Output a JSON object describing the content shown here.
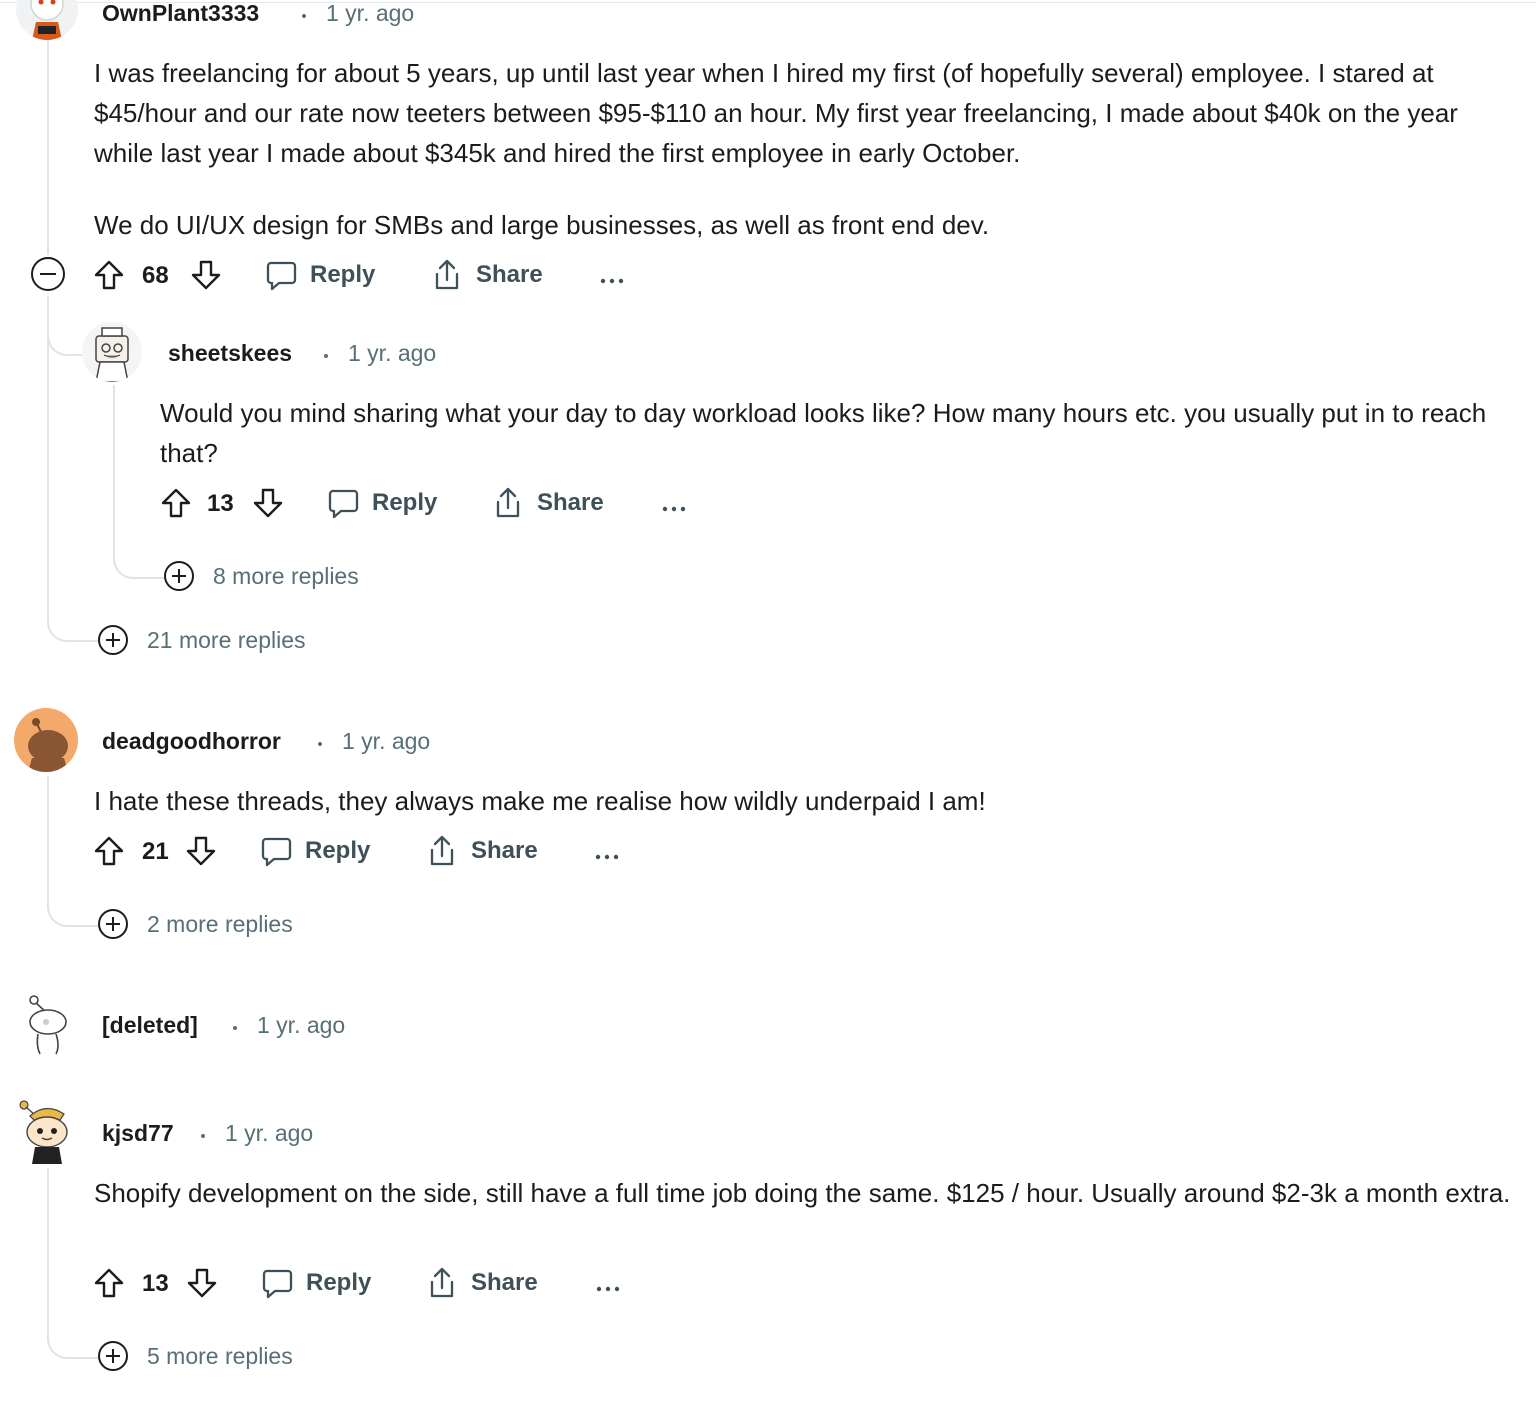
{
  "comments": [
    {
      "username": "OwnPlant3333",
      "time": "1 yr. ago",
      "paragraphs": [
        "I was freelancing for about 5 years, up until last year when I hired my first (of hopefully several) employee. I stared at $45/hour and our rate now teeters between $95-$110 an hour. My first year freelancing, I made about $40k on the year while last year I made about $345k and hired the first employee in early October.",
        "We do UI/UX design for SMBs and large businesses, as well as front end dev."
      ],
      "votes": "68",
      "more_replies": "21 more replies",
      "reply": {
        "username": "sheetskees",
        "time": "1 yr. ago",
        "text": "Would you mind sharing what your day to day workload looks like? How many hours etc. you usually put in to reach that?",
        "votes": "13",
        "more_replies": "8 more replies"
      }
    },
    {
      "username": "deadgoodhorror",
      "time": "1 yr. ago",
      "text": "I hate these threads, they always make me realise how wildly underpaid I am!",
      "votes": "21",
      "more_replies": "2 more replies"
    },
    {
      "username": "[deleted]",
      "time": "1 yr. ago"
    },
    {
      "username": "kjsd77",
      "time": "1 yr. ago",
      "text": "Shopify development on the side, still have a full time job doing the same. $125 / hour. Usually around $2-3k a month extra.",
      "votes": "13",
      "more_replies": "5 more replies"
    }
  ],
  "labels": {
    "reply": "Reply",
    "share": "Share"
  },
  "colors": {
    "text": "#1c1c1c",
    "meta": "#576f76",
    "action": "#3e5158",
    "thread_line": "#dfe3e6"
  }
}
